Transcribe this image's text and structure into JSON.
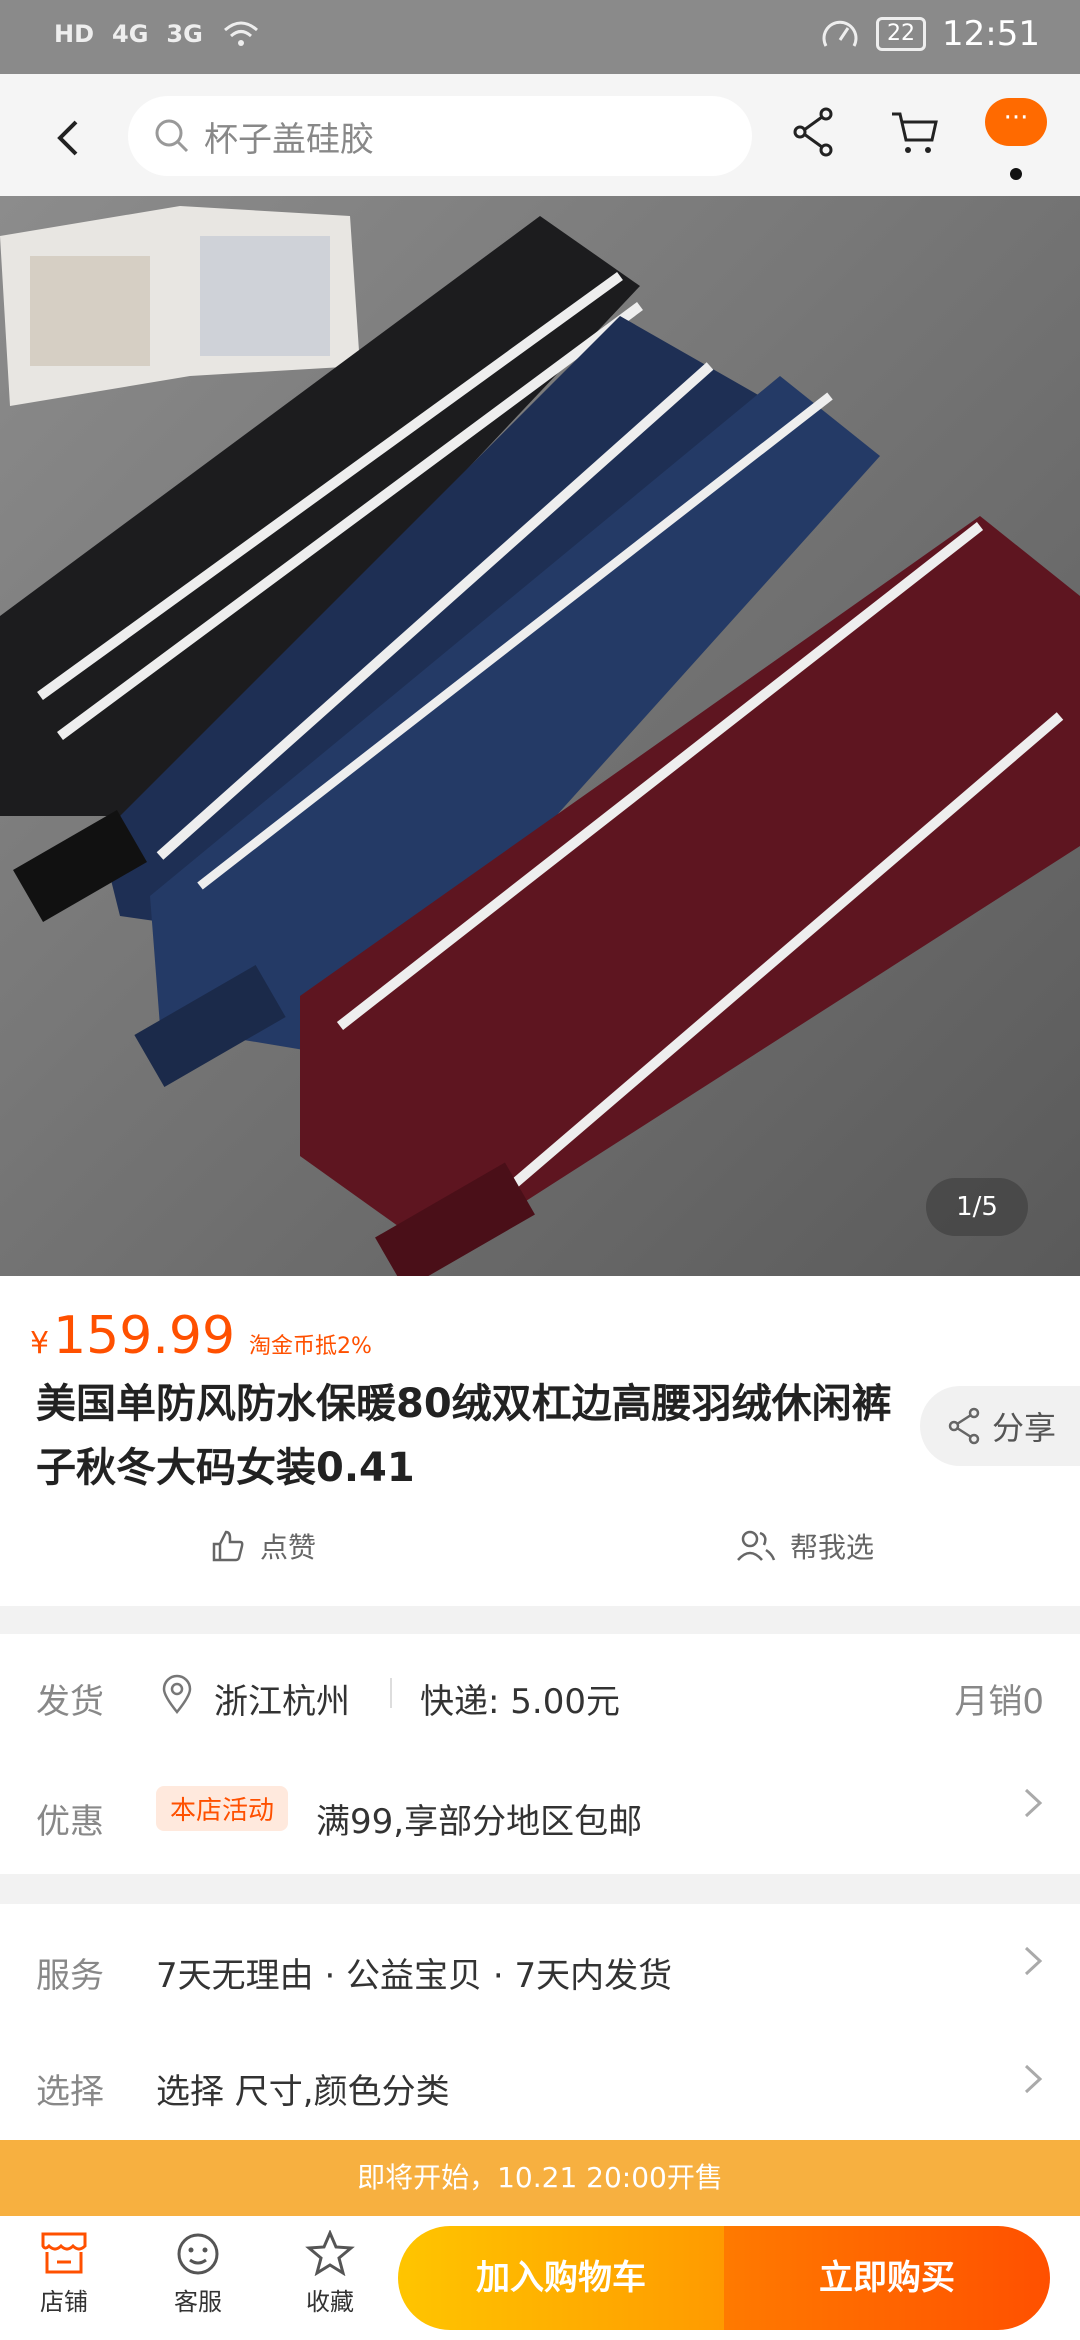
{
  "status_bar": {
    "hd": "HD",
    "net1": "4G",
    "net2": "3G",
    "battery": "22",
    "time": "12:51"
  },
  "top_nav": {
    "search_placeholder": "杯子盖硅胶",
    "more_label": "···"
  },
  "product": {
    "image_counter": "1/5",
    "price_symbol": "¥",
    "price": "159.99",
    "coin_tag": "淘金币抵2%",
    "title": "美国单防风防水保暖80绒双杠边高腰羽绒休闲裤子秋冬大码女装0.41",
    "share_label": "分享",
    "like_label": "点赞",
    "help_choose_label": "帮我选"
  },
  "shipping": {
    "label": "发货",
    "location": "浙江杭州",
    "express": "快递: 5.00元",
    "monthly_sales": "月销0"
  },
  "promo": {
    "label": "优惠",
    "tag": "本店活动",
    "text": "满99,享部分地区包邮"
  },
  "service": {
    "label": "服务",
    "text": "7天无理由 · 公益宝贝 · 7天内发货"
  },
  "select": {
    "label": "选择",
    "text": "选择 尺寸,颜色分类"
  },
  "sale_banner": "即将开始，10.21 20:00开售",
  "bottom_bar": {
    "store": "店铺",
    "service": "客服",
    "favorite": "收藏",
    "add_to_cart": "加入购物车",
    "buy_now": "立即购买"
  },
  "colors": {
    "accent": "#ff5000",
    "banner": "#f7b040",
    "cart_gradient_start": "#ffc500",
    "buy_gradient_end": "#ff5000"
  }
}
